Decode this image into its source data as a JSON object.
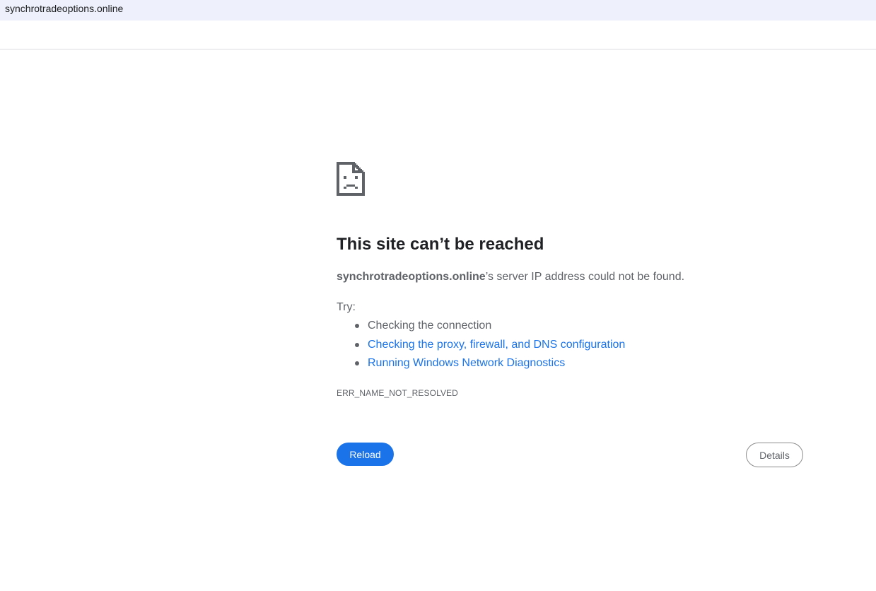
{
  "address_bar": {
    "url": "synchrotradeoptions.online"
  },
  "error_page": {
    "icon": "sad-page-icon",
    "title": "This site can’t be reached",
    "host": "synchrotradeoptions.online",
    "message_suffix": "’s server IP address could not be found.",
    "try_label": "Try:",
    "suggestions": [
      {
        "label": "Checking the connection",
        "is_link": false
      },
      {
        "label": "Checking the proxy, firewall, and DNS configuration",
        "is_link": true
      },
      {
        "label": "Running Windows Network Diagnostics",
        "is_link": true
      }
    ],
    "error_code": "ERR_NAME_NOT_RESOLVED",
    "reload_label": "Reload",
    "details_label": "Details"
  },
  "colors": {
    "accent": "#1a73e8",
    "text_secondary": "#5f6368",
    "address_bar_bg": "#eef1fb"
  }
}
